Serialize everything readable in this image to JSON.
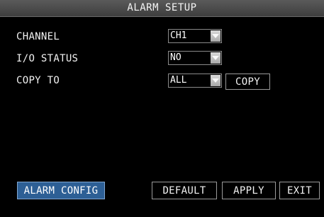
{
  "window": {
    "title": "ALARM SETUP"
  },
  "settings": {
    "channel": {
      "label": "CHANNEL",
      "value": "CH1"
    },
    "io_status": {
      "label": "I/O STATUS",
      "value": "NO"
    },
    "copy_to": {
      "label": "COPY TO",
      "value": "ALL",
      "button_label": "COPY"
    }
  },
  "footer": {
    "alarm_config_label": "ALARM CONFIG",
    "default_label": "DEFAULT",
    "apply_label": "APPLY",
    "exit_label": "EXIT"
  },
  "icons": {
    "dropdown_arrow": "chevron-down-icon"
  },
  "colors": {
    "background": "#000000",
    "title_bar": "#4a4a4a",
    "selected_button": "#2d5f95",
    "text": "#f2f2f2"
  }
}
